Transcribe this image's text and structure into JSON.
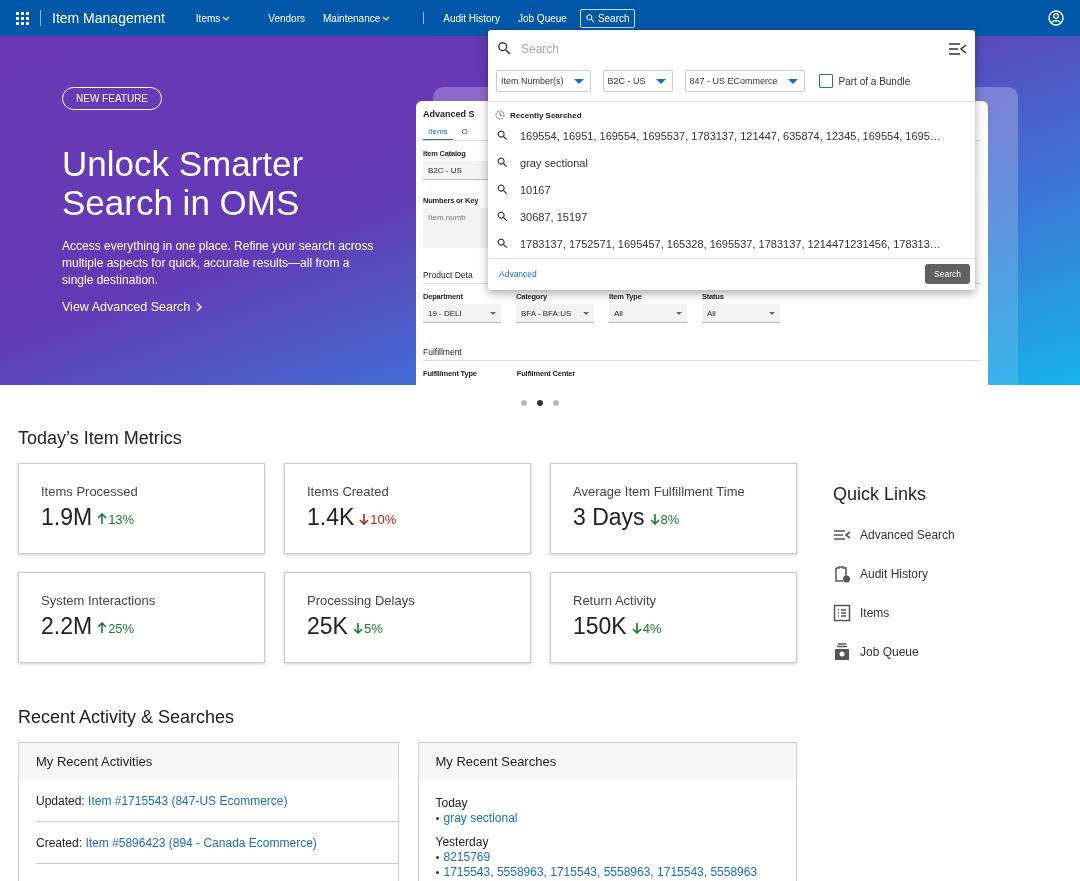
{
  "navbar": {
    "app_title": "Item Management",
    "items": [
      {
        "label": "Items",
        "kind": "menu",
        "selected": false
      },
      {
        "label": "Vendors",
        "kind": "link",
        "selected": false
      },
      {
        "label": "Maintenance",
        "kind": "menu",
        "selected": false
      },
      {
        "kind": "separator"
      },
      {
        "label": "Audit History",
        "kind": "link",
        "selected": false
      },
      {
        "label": "Job Queue",
        "kind": "link",
        "selected": false
      },
      {
        "label": "Search",
        "kind": "search",
        "selected": true
      }
    ]
  },
  "hero": {
    "badge": "NEW FEATURE",
    "title": "Unlock Smarter Search in OMS",
    "description": "Access everything in one place. Refine your search across multiple aspects for quick, accurate results—all from a single destination.",
    "link": "View Advanced Search",
    "preview": {
      "title": "Advanced S",
      "tabs": [
        {
          "label": "Items",
          "selected": true
        },
        {
          "label": "O",
          "selected": false
        }
      ],
      "catalog": {
        "label": "Item Catalog",
        "value": "B2C - US"
      },
      "numbers": {
        "label": "Numbers or Key",
        "placeholder": "Item numb"
      },
      "product_section": "Product Deta",
      "product_fields": [
        {
          "label": "Department",
          "value": "19 - DELI"
        },
        {
          "label": "Category",
          "value": "BFA - BFA:US"
        },
        {
          "label": "Item Type",
          "value": "All"
        },
        {
          "label": "Status",
          "value": "All"
        }
      ],
      "fulfillment_section": "Fulfillment",
      "fulfillment_fields": [
        {
          "label": "Fulfillment Type"
        },
        {
          "label": "Fulfilment Center"
        }
      ]
    }
  },
  "carousel": {
    "dots": [
      {
        "selected": false
      },
      {
        "selected": true
      },
      {
        "selected": false
      }
    ]
  },
  "search_dropdown": {
    "placeholder": "Search",
    "filters": [
      {
        "value": "Item Number(s)"
      },
      {
        "value": "B2C - US"
      },
      {
        "value": "847 - US ECommerce"
      }
    ],
    "bundle": {
      "label": "Part of a Bundle",
      "checked": false
    },
    "recent_title": "Recently Searched",
    "recent": [
      "169554, 16951, 169554, 1695537, 1783137, 121447, 635874, 12345, 169554, 1695…",
      "gray sectional",
      "10167",
      "30687, 15197",
      "1783137, 1752571, 1695457, 165328, 1695537, 1783137, 1214471231456, 178313…"
    ],
    "advanced_link": "Advanced",
    "search_button": "Search"
  },
  "metrics": {
    "title": "Today’s Item Metrics",
    "cards": [
      {
        "label": "Items Processed",
        "value": "1.9M",
        "change": "13%",
        "increase": true,
        "favorable": true
      },
      {
        "label": "Items Created",
        "value": "1.4K",
        "change": "10%",
        "increase": false,
        "favorable": false
      },
      {
        "label": "Average Item Fulfillment Time",
        "value": "3 Days",
        "change": "8%",
        "increase": false,
        "favorable": true
      },
      {
        "label": "System Interactions",
        "value": "2.2M",
        "change": "25%",
        "increase": true,
        "favorable": true
      },
      {
        "label": "Processing Delays",
        "value": "25K",
        "change": "5%",
        "increase": false,
        "favorable": true
      },
      {
        "label": "Return Activity",
        "value": "150K",
        "change": "4%",
        "increase": false,
        "favorable": true
      }
    ]
  },
  "quick_links": {
    "title": "Quick Links",
    "items": [
      {
        "label": "Advanced Search"
      },
      {
        "label": "Audit History"
      },
      {
        "label": "Items"
      },
      {
        "label": "Job Queue"
      }
    ]
  },
  "recent": {
    "title": "Recent Activity & Searches",
    "activities": {
      "title": "My Recent Activities",
      "items": [
        {
          "action": "Updated:",
          "link": "Item #1715543 (847-US Ecommerce)"
        },
        {
          "action": "Created:",
          "link": "Item #5896423 (894 - Canada Ecommerce)"
        }
      ]
    },
    "searches": {
      "title": "My Recent Searches",
      "groups": [
        {
          "label": "Today",
          "items": [
            "gray sectional"
          ]
        },
        {
          "label": "Yesterday",
          "items": [
            "8215769",
            "1715543, 5558963, 1715543, 5558963, 1715543, 5558963"
          ]
        }
      ]
    }
  }
}
